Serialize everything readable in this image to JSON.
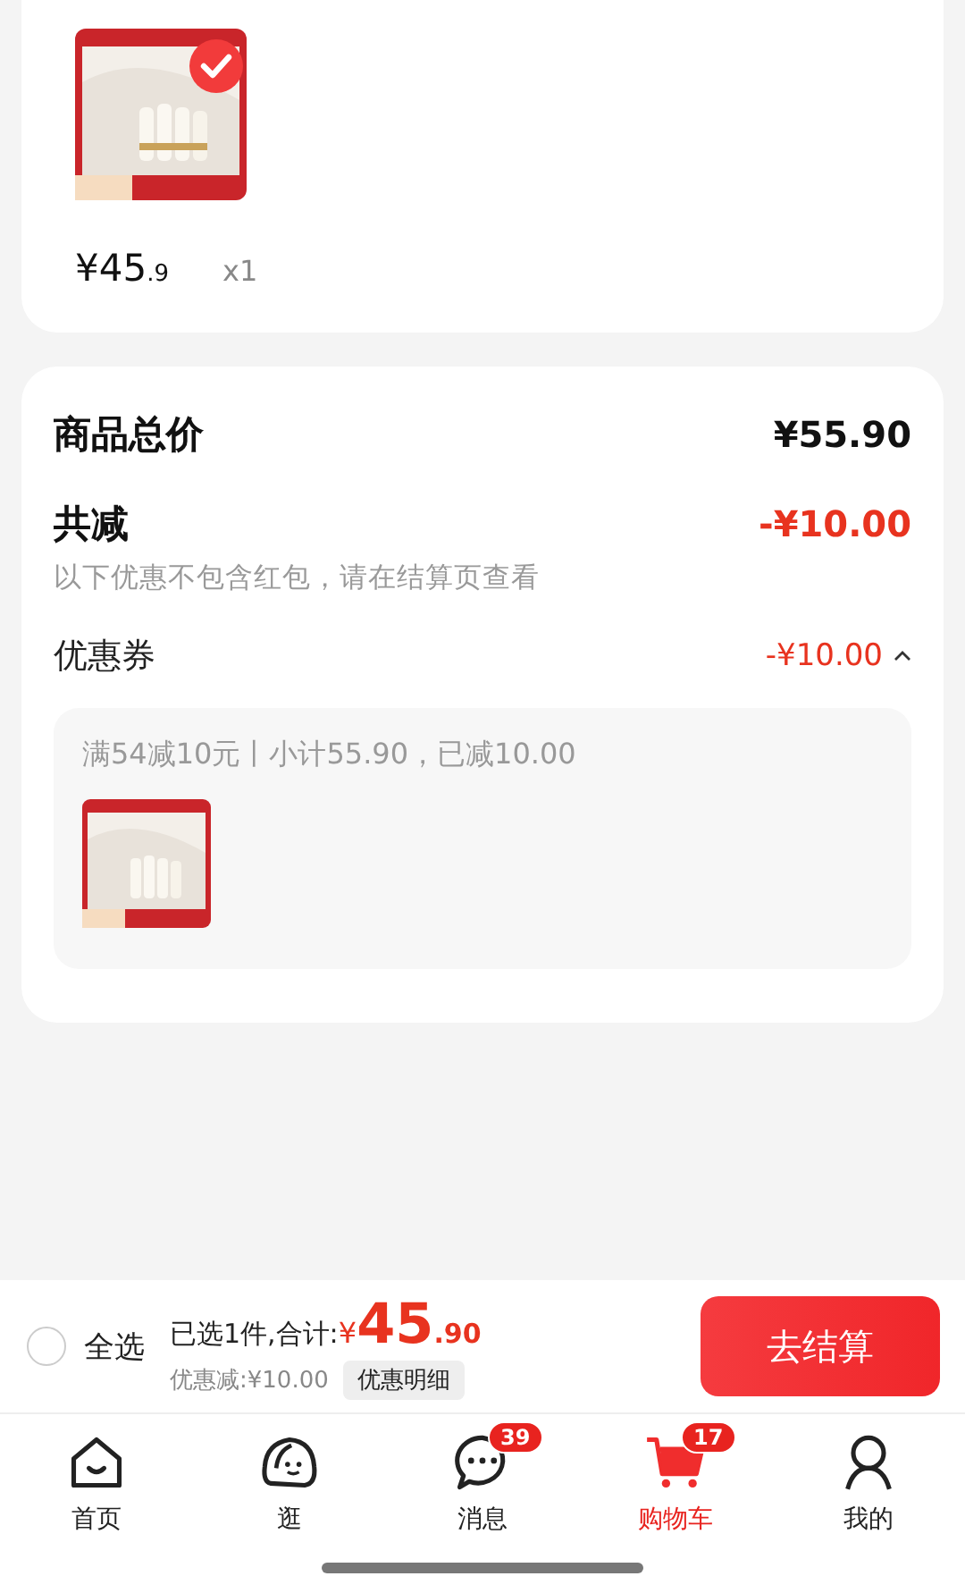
{
  "cart_item": {
    "kind": "picture",
    "selected": true,
    "price_main": "¥45",
    "price_decimal": ".9",
    "quantity": "x1"
  },
  "summary": {
    "total_label": "商品总价",
    "total_value": "¥55.90",
    "discount_label": "共减",
    "discount_value": "-¥10.00",
    "note": "以下优惠不包含红包，请在结算页查看",
    "coupon_label": "优惠券",
    "coupon_value": "-¥10.00",
    "coupon_expanded": true,
    "coupon_detail": "满54减10元丨小计55.90，已减10.00"
  },
  "checkout_bar": {
    "select_all_checked": false,
    "select_all_label": "全选",
    "selected_label": "已选1件,合计:",
    "currency": "¥",
    "total_integer": "45",
    "total_decimal": ".90",
    "discount_text": "优惠减:¥10.00",
    "detail_button": "优惠明细",
    "checkout_button": "去结算"
  },
  "tabs": [
    {
      "label": "首页",
      "kind": "home",
      "selected": false
    },
    {
      "label": "逛",
      "kind": "browse",
      "selected": false
    },
    {
      "label": "消息",
      "kind": "message",
      "selected": false,
      "badge": "39"
    },
    {
      "label": "购物车",
      "kind": "cart",
      "selected": true,
      "badge": "17"
    },
    {
      "label": "我的",
      "kind": "profile",
      "selected": false
    }
  ]
}
